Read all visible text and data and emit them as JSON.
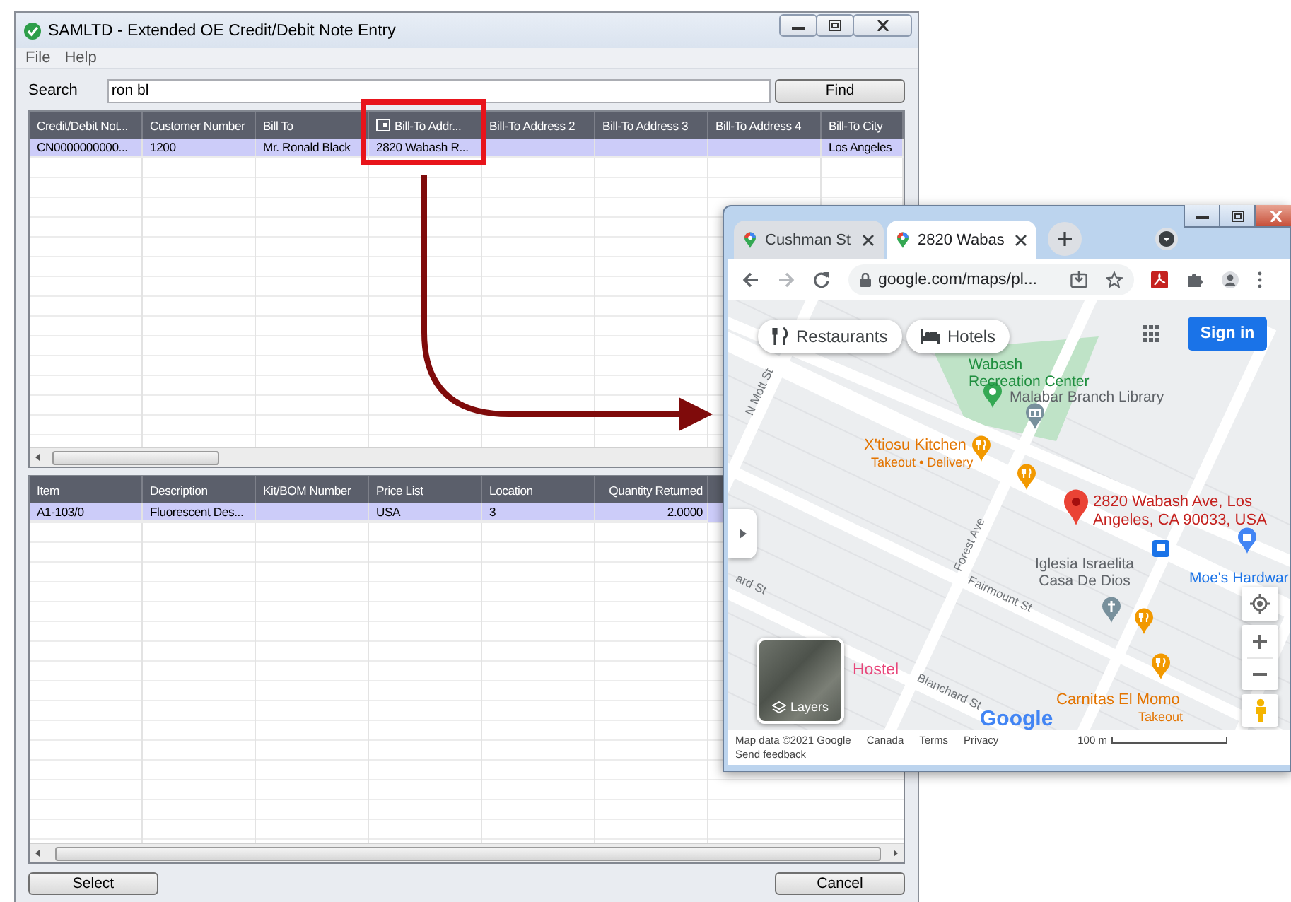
{
  "main_window": {
    "title": "SAMLTD - Extended OE Credit/Debit Note Entry",
    "menu": [
      "File",
      "Help"
    ],
    "search": {
      "label": "Search",
      "value": "ron bl"
    },
    "find_button": "Find",
    "buttons": [
      "Select",
      "Cancel"
    ]
  },
  "header_grid": {
    "columns": [
      {
        "label": "Credit/Debit Not...",
        "kind": "text",
        "highlighted": false
      },
      {
        "label": "Customer Number",
        "kind": "text",
        "highlighted": false
      },
      {
        "label": "Bill To",
        "kind": "text",
        "highlighted": false
      },
      {
        "label": "Bill-To Addr...",
        "kind": "text",
        "highlighted": true
      },
      {
        "label": "Bill-To Address 2",
        "kind": "text",
        "highlighted": false
      },
      {
        "label": "Bill-To Address 3",
        "kind": "text",
        "highlighted": false
      },
      {
        "label": "Bill-To Address 4",
        "kind": "text",
        "highlighted": false
      },
      {
        "label": "Bill-To City",
        "kind": "text",
        "highlighted": false
      }
    ],
    "rows": [
      {
        "cells": [
          "CN0000000000...",
          "1200",
          "Mr. Ronald Black",
          "2820 Wabash R...",
          null,
          null,
          null,
          "Los Angeles"
        ],
        "selected": true
      }
    ]
  },
  "detail_grid": {
    "columns": [
      {
        "label": "Item",
        "kind": "text"
      },
      {
        "label": "Description",
        "kind": "text"
      },
      {
        "label": "Kit/BOM Number",
        "kind": "text"
      },
      {
        "label": "Price List",
        "kind": "text"
      },
      {
        "label": "Location",
        "kind": "text"
      },
      {
        "label": "Quantity Returned",
        "kind": "number"
      }
    ],
    "rows": [
      {
        "cells": [
          "A1-103/0",
          "Fluorescent Des...",
          null,
          "USA",
          "3",
          "2.0000"
        ],
        "selected": true
      }
    ]
  },
  "browser": {
    "tabs": [
      {
        "title": "Cushman St",
        "selected": false
      },
      {
        "title": "2820 Wabas",
        "selected": true
      }
    ],
    "address": "google.com/maps/pl...",
    "map": {
      "chips": [
        "Restaurants",
        "Hotels"
      ],
      "sign_in": "Sign in",
      "labels": [
        {
          "text": "Wabash Recreation Center",
          "kind": "park"
        },
        {
          "text": "Malabar Branch Library",
          "kind": "place"
        },
        {
          "text": "N Mott St",
          "kind": "street"
        },
        {
          "text": "X'tiosu Kitchen",
          "kind": "food"
        },
        {
          "text": "Takeout • Delivery",
          "kind": "food-note"
        },
        {
          "text": "2820 Wabash Ave, Los Angeles, CA 90033, USA",
          "kind": "address"
        },
        {
          "text": "Forest Ave",
          "kind": "street"
        },
        {
          "text": "Iglesia Israelita Casa De Dios",
          "kind": "place"
        },
        {
          "text": "Moe's Hardwar",
          "kind": "shop"
        },
        {
          "text": "ard St",
          "kind": "street"
        },
        {
          "text": "Fairmount St",
          "kind": "street"
        },
        {
          "text": "Hostel",
          "kind": "lodging"
        },
        {
          "text": "Blanchard St",
          "kind": "street"
        },
        {
          "text": "Carnitas El Momo",
          "kind": "food"
        },
        {
          "text": "Takeout",
          "kind": "food-note"
        }
      ],
      "layers": "Layers",
      "logo": "Google",
      "footer": [
        "Map data ©2021 Google",
        "Canada",
        "Terms",
        "Privacy"
      ],
      "scale": "100 m",
      "feedback": "Send feedback"
    }
  }
}
